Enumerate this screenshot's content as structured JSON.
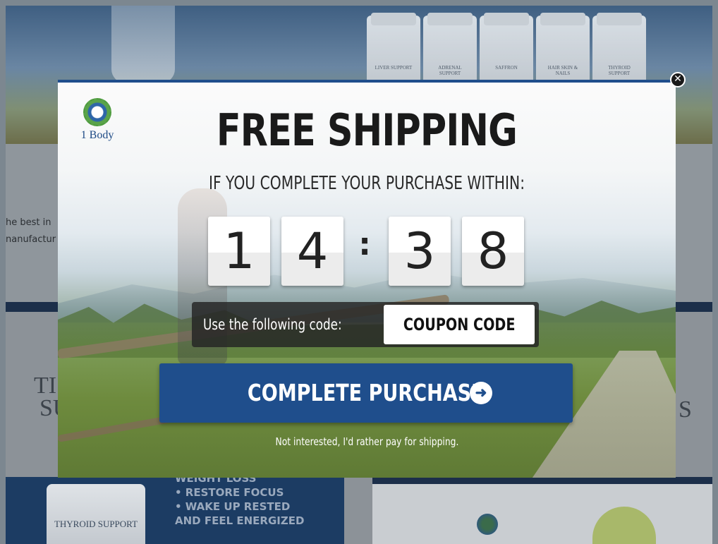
{
  "background": {
    "bottles": [
      "LIVER SUPPORT",
      "ADRENAL SUPPORT",
      "SAFFRON",
      "HAIR SKIN & NAILS",
      "THYROID SUPPORT"
    ],
    "snippet_line1": "he best in",
    "snippet_line2": "nanufactur",
    "big_left": "TI",
    "big_left2": "SU",
    "big_right": "S",
    "product_label": "THYROID SUPPORT",
    "benefits": [
      "WEIGHT LOSS",
      "• RESTORE FOCUS",
      "• WAKE UP RESTED",
      "AND FEEL ENERGIZED"
    ]
  },
  "modal": {
    "logo_text": "1 Body",
    "headline": "FREE SHIPPING",
    "subhead": "IF YOU COMPLETE YOUR PURCHASE WITHIN:",
    "timer": {
      "digits": [
        "1",
        "4",
        "3",
        "8"
      ],
      "separator": ":"
    },
    "coupon": {
      "label": "Use the following code:",
      "code": "COUPON CODE"
    },
    "cta_label": "COMPLETE PURCHASE",
    "cta_icon": "arrow-right-circle-icon",
    "decline_label": "Not interested, I'd rather pay for shipping.",
    "close_icon": "close-icon"
  },
  "colors": {
    "accent_blue": "#1f4e8c",
    "coupon_bar": "#232323"
  }
}
